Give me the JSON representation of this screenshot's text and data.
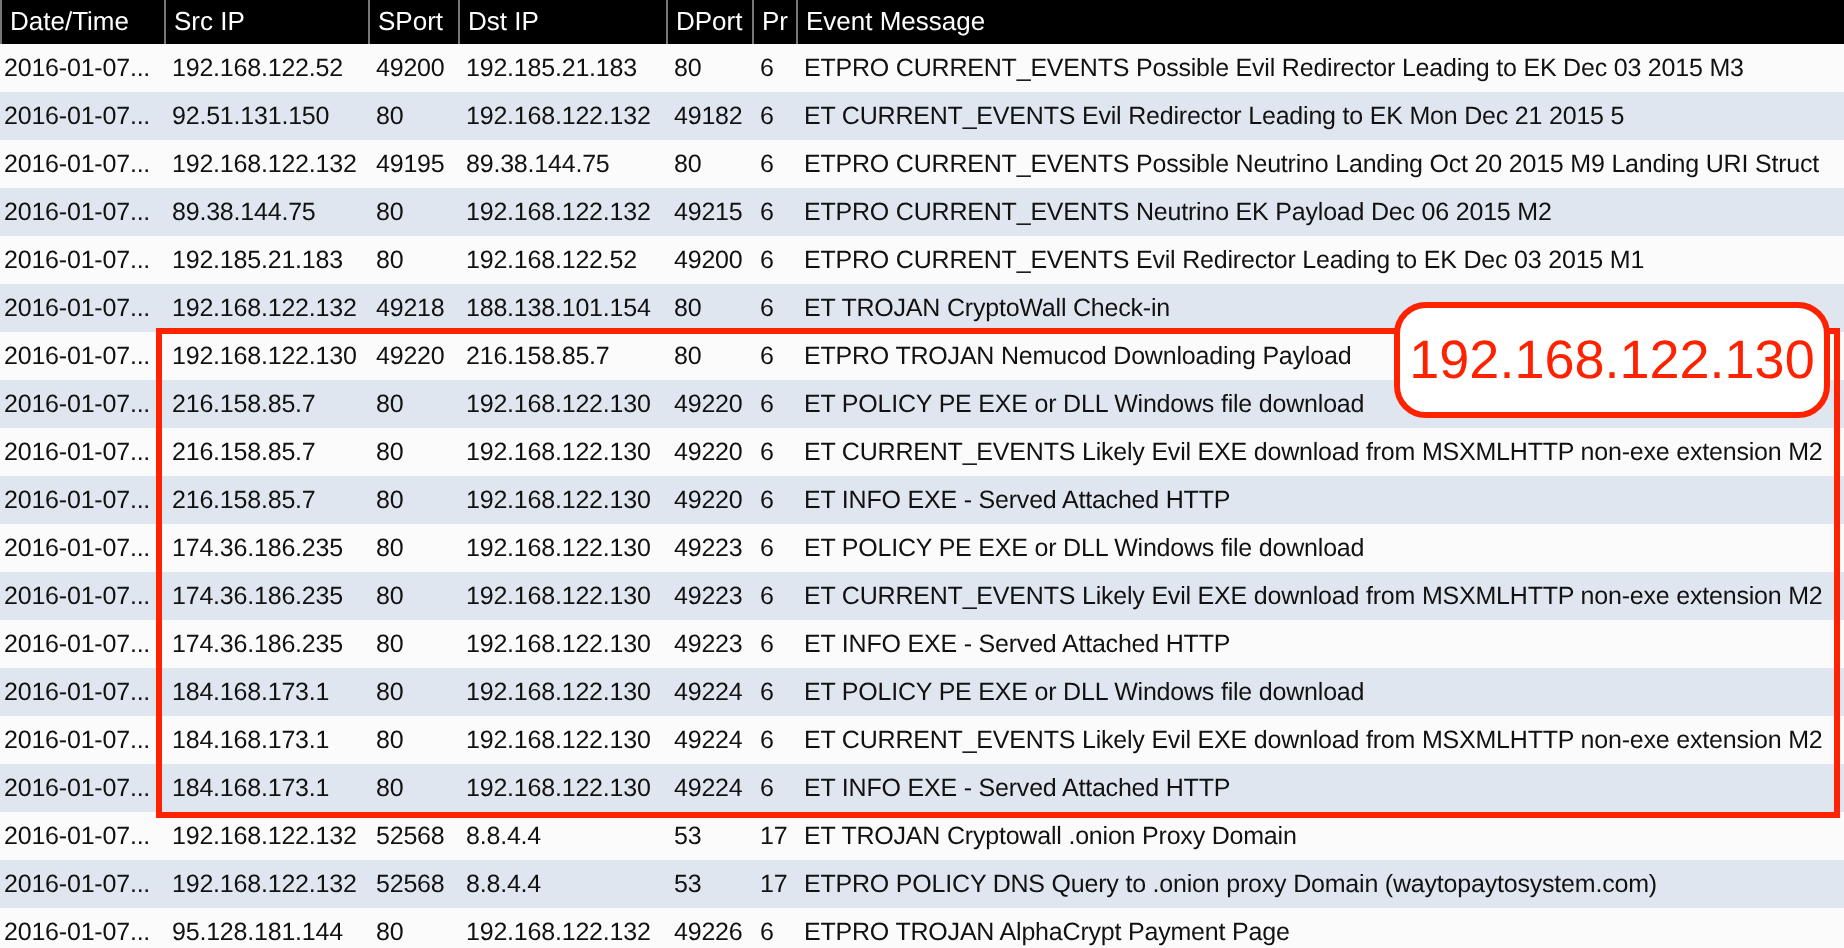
{
  "table": {
    "columns": [
      "Date/Time",
      "Src IP",
      "SPort",
      "Dst IP",
      "DPort",
      "Pr",
      "Event Message"
    ],
    "rows": [
      {
        "cells": [
          "2016-01-07...",
          "192.168.122.52",
          "49200",
          "192.185.21.183",
          "80",
          "6",
          "ETPRO CURRENT_EVENTS Possible Evil Redirector Leading to EK Dec 03 2015 M3"
        ],
        "highlighted": false
      },
      {
        "cells": [
          "2016-01-07...",
          "92.51.131.150",
          "80",
          "192.168.122.132",
          "49182",
          "6",
          "ET CURRENT_EVENTS Evil Redirector Leading to EK Mon Dec 21 2015 5"
        ],
        "highlighted": false
      },
      {
        "cells": [
          "2016-01-07...",
          "192.168.122.132",
          "49195",
          "89.38.144.75",
          "80",
          "6",
          "ETPRO CURRENT_EVENTS Possible Neutrino Landing Oct 20 2015 M9 Landing URI Struct"
        ],
        "highlighted": false
      },
      {
        "cells": [
          "2016-01-07...",
          "89.38.144.75",
          "80",
          "192.168.122.132",
          "49215",
          "6",
          "ETPRO CURRENT_EVENTS Neutrino EK Payload Dec 06 2015 M2"
        ],
        "highlighted": false
      },
      {
        "cells": [
          "2016-01-07...",
          "192.185.21.183",
          "80",
          "192.168.122.52",
          "49200",
          "6",
          "ETPRO CURRENT_EVENTS Evil Redirector Leading to EK Dec 03 2015 M1"
        ],
        "highlighted": false
      },
      {
        "cells": [
          "2016-01-07...",
          "192.168.122.132",
          "49218",
          "188.138.101.154",
          "80",
          "6",
          "ET TROJAN CryptoWall Check-in"
        ],
        "highlighted": false
      },
      {
        "cells": [
          "2016-01-07...",
          "192.168.122.130",
          "49220",
          "216.158.85.7",
          "80",
          "6",
          "ETPRO TROJAN Nemucod Downloading Payload"
        ],
        "highlighted": true
      },
      {
        "cells": [
          "2016-01-07...",
          "216.158.85.7",
          "80",
          "192.168.122.130",
          "49220",
          "6",
          "ET POLICY PE EXE or DLL Windows file download"
        ],
        "highlighted": true
      },
      {
        "cells": [
          "2016-01-07...",
          "216.158.85.7",
          "80",
          "192.168.122.130",
          "49220",
          "6",
          "ET CURRENT_EVENTS Likely Evil EXE download from MSXMLHTTP non-exe extension M2"
        ],
        "highlighted": true
      },
      {
        "cells": [
          "2016-01-07...",
          "216.158.85.7",
          "80",
          "192.168.122.130",
          "49220",
          "6",
          "ET INFO EXE - Served Attached HTTP"
        ],
        "highlighted": true
      },
      {
        "cells": [
          "2016-01-07...",
          "174.36.186.235",
          "80",
          "192.168.122.130",
          "49223",
          "6",
          "ET POLICY PE EXE or DLL Windows file download"
        ],
        "highlighted": true
      },
      {
        "cells": [
          "2016-01-07...",
          "174.36.186.235",
          "80",
          "192.168.122.130",
          "49223",
          "6",
          "ET CURRENT_EVENTS Likely Evil EXE download from MSXMLHTTP non-exe extension M2"
        ],
        "highlighted": true
      },
      {
        "cells": [
          "2016-01-07...",
          "174.36.186.235",
          "80",
          "192.168.122.130",
          "49223",
          "6",
          "ET INFO EXE - Served Attached HTTP"
        ],
        "highlighted": true
      },
      {
        "cells": [
          "2016-01-07...",
          "184.168.173.1",
          "80",
          "192.168.122.130",
          "49224",
          "6",
          "ET POLICY PE EXE or DLL Windows file download"
        ],
        "highlighted": true
      },
      {
        "cells": [
          "2016-01-07...",
          "184.168.173.1",
          "80",
          "192.168.122.130",
          "49224",
          "6",
          "ET CURRENT_EVENTS Likely Evil EXE download from MSXMLHTTP non-exe extension M2"
        ],
        "highlighted": true
      },
      {
        "cells": [
          "2016-01-07...",
          "184.168.173.1",
          "80",
          "192.168.122.130",
          "49224",
          "6",
          "ET INFO EXE - Served Attached HTTP"
        ],
        "highlighted": true
      },
      {
        "cells": [
          "2016-01-07...",
          "192.168.122.132",
          "52568",
          "8.8.4.4",
          "53",
          "17",
          "ET TROJAN Cryptowall .onion Proxy Domain"
        ],
        "highlighted": false
      },
      {
        "cells": [
          "2016-01-07...",
          "192.168.122.132",
          "52568",
          "8.8.4.4",
          "53",
          "17",
          "ETPRO POLICY DNS Query to .onion proxy Domain (waytopaytosystem.com)"
        ],
        "highlighted": false
      },
      {
        "cells": [
          "2016-01-07...",
          "95.128.181.144",
          "80",
          "192.168.122.132",
          "49226",
          "6",
          "ETPRO TROJAN AlphaCrypt Payment Page"
        ],
        "highlighted": false
      }
    ]
  },
  "annotation": {
    "label": "192.168.122.130"
  }
}
